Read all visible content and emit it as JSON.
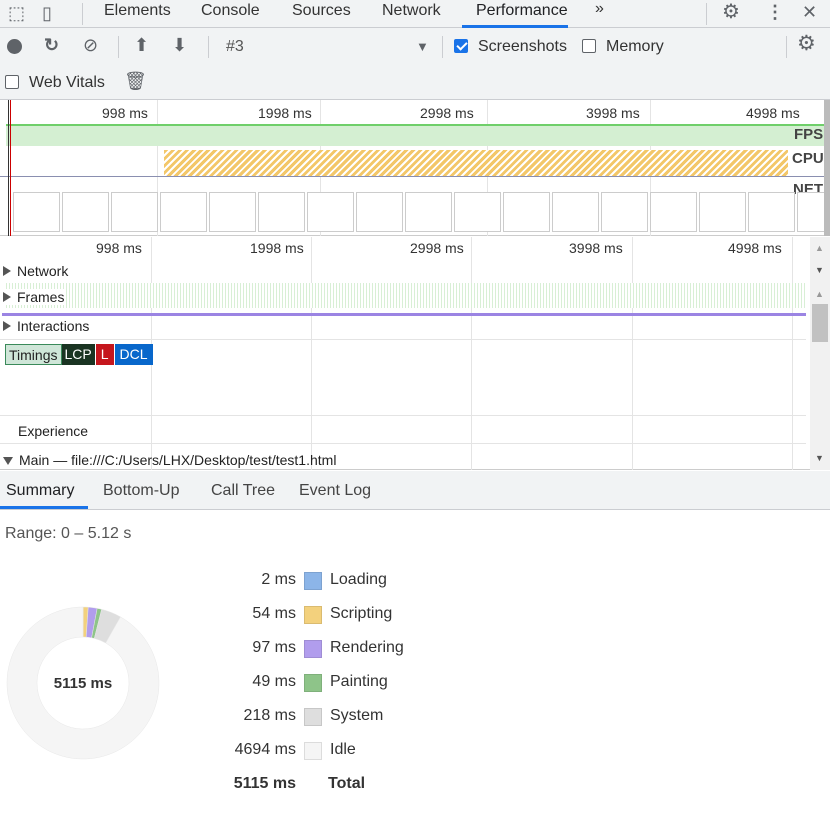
{
  "tabs": {
    "items": [
      "Elements",
      "Console",
      "Sources",
      "Network",
      "Performance"
    ],
    "active": "Performance",
    "more": "»"
  },
  "toolbar": {
    "recording": "#3",
    "screenshots_label": "Screenshots",
    "screenshots_checked": true,
    "memory_label": "Memory",
    "memory_checked": false,
    "web_vitals_label": "Web Vitals",
    "web_vitals_checked": false
  },
  "overview": {
    "ticks": [
      "998 ms",
      "1998 ms",
      "2998 ms",
      "3998 ms",
      "4998 ms"
    ],
    "fps_label": "FPS",
    "cpu_label": "CPU",
    "net_label": "NET"
  },
  "timeline": {
    "ticks": [
      "998 ms",
      "1998 ms",
      "2998 ms",
      "3998 ms",
      "4998 ms"
    ],
    "tracks": {
      "network": "Network",
      "frames": "Frames",
      "interactions": "Interactions",
      "timings": "Timings",
      "experience": "Experience",
      "main": "Main — file:///C:/Users/LHX/Desktop/test/test1.html"
    },
    "markers": {
      "lcp": "LCP",
      "l": "L",
      "dcl": "DCL"
    }
  },
  "bottom_tabs": [
    "Summary",
    "Bottom-Up",
    "Call Tree",
    "Event Log"
  ],
  "summary": {
    "range": "Range: 0 – 5.12 s",
    "total_center": "5115 ms",
    "items": [
      {
        "value": "2 ms",
        "ms": 2,
        "label": "Loading",
        "color": "#8cb5e8"
      },
      {
        "value": "54 ms",
        "ms": 54,
        "label": "Scripting",
        "color": "#f3d17d"
      },
      {
        "value": "97 ms",
        "ms": 97,
        "label": "Rendering",
        "color": "#b19ded"
      },
      {
        "value": "49 ms",
        "ms": 49,
        "label": "Painting",
        "color": "#8ec489"
      },
      {
        "value": "218 ms",
        "ms": 218,
        "label": "System",
        "color": "#dedede"
      },
      {
        "value": "4694 ms",
        "ms": 4694,
        "label": "Idle",
        "color": "#f5f5f5"
      }
    ],
    "total_value": "5115 ms",
    "total_label": "Total"
  },
  "colors": {
    "accent": "#1a73e8",
    "fps": "#d4efd2",
    "cpu": "#f3c769",
    "lcp": "#1a3422",
    "l": "#c5161d",
    "dcl": "#0867cb",
    "frames_line": "#9b84e3"
  }
}
